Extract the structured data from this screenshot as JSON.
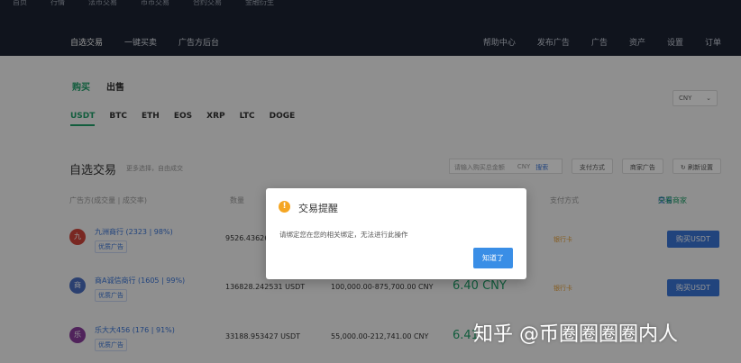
{
  "topbar": {
    "menu": [
      "首页",
      "行情",
      "法币交易",
      "币币交易",
      "合约交易",
      "金融衍生"
    ],
    "sub_nav": [
      "自选交易",
      "一键买卖",
      "广告方后台"
    ],
    "right_nav": [
      "帮助中心",
      "发布广告",
      "广告",
      "资产",
      "设置",
      "订单"
    ]
  },
  "main": {
    "trade_buy": "购买",
    "trade_sell": "出售",
    "coins": [
      "USDT",
      "BTC",
      "ETH",
      "EOS",
      "XRP",
      "LTC",
      "DOGE"
    ],
    "currency": "CNY",
    "section_title": "自选交易",
    "section_sub": "更多选择，自由成交",
    "amount_placeholder": "请输入购买总金额",
    "amount_unit": "CNY",
    "search": "搜索",
    "btn_pay": "支付方式",
    "btn_merchant": "商家广告",
    "btn_refresh": "刷新设置",
    "headers": {
      "merchant": "广告方(成交量 | 成交率)",
      "qty": "数量",
      "pay": "支付方式",
      "right": "交易",
      "right_green": "只看商家"
    },
    "rows": [
      {
        "avatar": "九",
        "avatar_color": "#d0463c",
        "name": "九洲商行 (2323 | 98%)",
        "tag": "优质广告",
        "qty": "9526.43626",
        "limit": "",
        "price": "",
        "pay": "银行卡",
        "buy": "购买USDT"
      },
      {
        "avatar": "商",
        "avatar_color": "#4a6fc2",
        "name": "商A诚信商行 (1605 | 99%)",
        "tag": "优质广告",
        "qty": "136828.242531 USDT",
        "limit": "100,000.00-875,700.00 CNY",
        "price": "6.40 CNY",
        "pay": "银行卡",
        "buy": "购买USDT"
      },
      {
        "avatar": "乐",
        "avatar_color": "#8a3d9e",
        "name": "乐大大456 (176 | 91%)",
        "tag": "优质广告",
        "qty": "33188.953427 USDT",
        "limit": "55,000.00-212,741.00 CNY",
        "price": "6.41",
        "pay": "",
        "buy": ""
      }
    ]
  },
  "modal": {
    "title": "交易提醒",
    "message": "请绑定您在您的相关绑定，无法进行此操作",
    "ok": "知道了"
  },
  "watermark": "知乎 @币圈圈圈圈内人"
}
